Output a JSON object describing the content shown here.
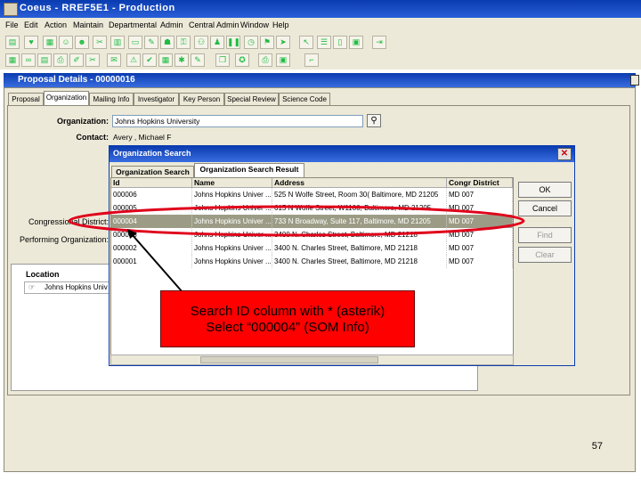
{
  "app": {
    "title": "Coeus  -  RREF5E1  -  Production"
  },
  "menu": [
    "File",
    "Edit",
    "Action",
    "Maintain",
    "Departmental",
    "Admin",
    "Central Admin",
    "Window",
    "Help"
  ],
  "proposal": {
    "title": "Proposal Details - 00000016",
    "tabs": [
      "Proposal",
      "Organization",
      "Mailing Info",
      "Investigator",
      "Key Person",
      "Special Review",
      "Science Code"
    ],
    "active_tab": "Organization",
    "organization_label": "Organization:",
    "organization_value": "Johns Hopkins University",
    "contact_label": "Contact:",
    "contact_value": "Avery , Michael F",
    "congressional_label": "Congressional District:",
    "performing_label": "Performing Organization:",
    "location_header": "Location",
    "location_value": "Johns Hopkins Univ"
  },
  "dialog": {
    "title": "Organization Search",
    "tabs": [
      "Organization Search",
      "Organization Search Result"
    ],
    "active_tab": "Organization Search Result",
    "columns": [
      "Id",
      "Name",
      "Address",
      "Congr District"
    ],
    "rows": [
      {
        "id": "000006",
        "name": "Johns Hopkins Univer ...",
        "address": "525 N Wolfe Street, Room 30( Baltimore, MD 21205",
        "district": "MD 007",
        "selected": false
      },
      {
        "id": "000005",
        "name": "Johns Hopkins Univer ...",
        "address": "615 N Wolfe Street, W1100, Baltimore, MD 21205",
        "district": "MD 007",
        "selected": false
      },
      {
        "id": "000004",
        "name": "Johns Hopkins Univer ...",
        "address": "733 N Broadway, Suite 117, Baltimore, MD 21205",
        "district": "MD 007",
        "selected": true
      },
      {
        "id": "000003",
        "name": "Johns Hopkins Univer ...",
        "address": "3400 N. Charles Street, Baltimore, MD 21218",
        "district": "MD 007",
        "selected": false
      },
      {
        "id": "000002",
        "name": "Johns Hopkins Univer ...",
        "address": "3400 N. Charles Street, Baltimore, MD 21218",
        "district": "MD 007",
        "selected": false
      },
      {
        "id": "000001",
        "name": "Johns Hopkins Univer ...",
        "address": "3400 N. Charles Street, Baltimore, MD 21218",
        "district": "MD 007",
        "selected": false
      }
    ],
    "buttons": {
      "ok": "OK",
      "cancel": "Cancel",
      "find": "Find",
      "clear": "Clear"
    }
  },
  "annotation": {
    "line1": "Search ID column with * (asterik)",
    "line2": "Select “000004” (SOM Info)",
    "color": "#ff0000"
  },
  "page_number": "57",
  "colors": {
    "title_bar": "#0a3bb0",
    "selected_row": "#9c9c86",
    "highlight_ellipse": "#e0001a"
  }
}
